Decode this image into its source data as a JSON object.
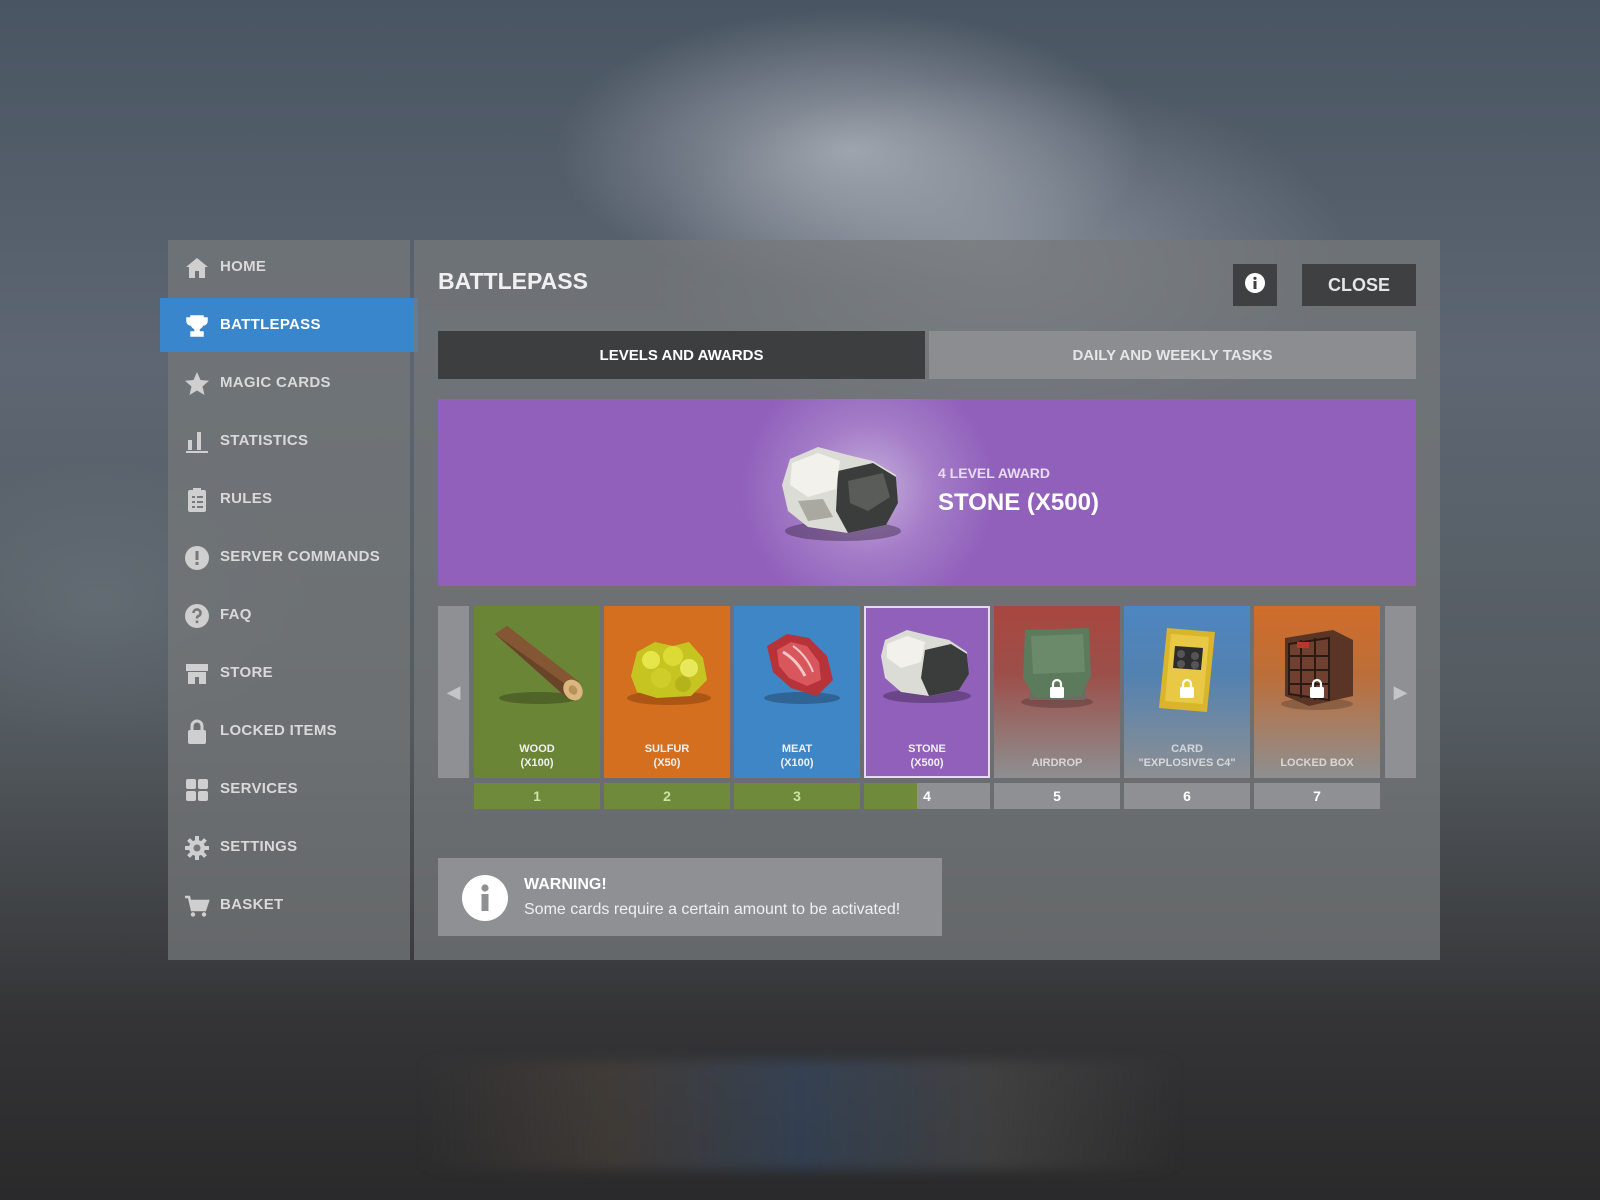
{
  "sidebar": {
    "items": [
      {
        "label": "HOME",
        "icon": "home-icon",
        "active": false
      },
      {
        "label": "BATTLEPASS",
        "icon": "trophy-icon",
        "active": true
      },
      {
        "label": "MAGIC CARDS",
        "icon": "star-icon",
        "active": false
      },
      {
        "label": "STATISTICS",
        "icon": "bar-chart-icon",
        "active": false
      },
      {
        "label": "RULES",
        "icon": "clipboard-icon",
        "active": false
      },
      {
        "label": "SERVER COMMANDS",
        "icon": "exclamation-icon",
        "active": false
      },
      {
        "label": "FAQ",
        "icon": "question-icon",
        "active": false
      },
      {
        "label": "STORE",
        "icon": "store-icon",
        "active": false
      },
      {
        "label": "LOCKED ITEMS",
        "icon": "lock-icon",
        "active": false
      },
      {
        "label": "SERVICES",
        "icon": "grid-icon",
        "active": false
      },
      {
        "label": "SETTINGS",
        "icon": "gear-icon",
        "active": false
      },
      {
        "label": "BASKET",
        "icon": "cart-icon",
        "active": false
      }
    ]
  },
  "header": {
    "title": "BATTLEPASS",
    "info_icon": "info-icon",
    "close_label": "CLOSE"
  },
  "tabs": [
    {
      "label": "LEVELS AND AWARDS",
      "active": true
    },
    {
      "label": "DAILY AND WEEKLY TASKS",
      "active": false
    }
  ],
  "banner": {
    "subtitle": "4 LEVEL AWARD",
    "title": "STONE (X500)",
    "color": "#9060bb"
  },
  "carousel": {
    "prev_icon": "◀",
    "next_icon": "▶",
    "cards": [
      {
        "label": "WOOD\n(X100)",
        "art": "wood-icon",
        "color": "#6b8536",
        "locked": false,
        "selected": false
      },
      {
        "label": "SULFUR\n(X50)",
        "art": "sulfur-icon",
        "color": "#d46f1f",
        "locked": false,
        "selected": false
      },
      {
        "label": "MEAT\n(X100)",
        "art": "meat-icon",
        "color": "#3f86c6",
        "locked": false,
        "selected": false
      },
      {
        "label": "STONE\n(X500)",
        "art": "stone-icon",
        "color": "#9060bb",
        "locked": false,
        "selected": true
      },
      {
        "label": "AIRDROP",
        "art": "airdrop-icon",
        "color": "#a8473f",
        "locked": true,
        "selected": false
      },
      {
        "label": "CARD\n\"EXPLOSIVES C4\"",
        "art": "c4-card-icon",
        "color": "#4d86c0",
        "locked": true,
        "selected": false
      },
      {
        "label": "LOCKED BOX",
        "art": "crate-icon",
        "color": "#d06d2a",
        "locked": true,
        "selected": false
      }
    ],
    "levels": [
      {
        "num": "1",
        "progress": 1.0
      },
      {
        "num": "2",
        "progress": 1.0
      },
      {
        "num": "3",
        "progress": 1.0
      },
      {
        "num": "4",
        "progress": 0.42
      },
      {
        "num": "5",
        "progress": 0
      },
      {
        "num": "6",
        "progress": 0
      },
      {
        "num": "7",
        "progress": 0
      }
    ]
  },
  "warning": {
    "title": "WARNING!",
    "text": "Some cards require a certain amount to be activated!",
    "icon": "info-icon"
  }
}
